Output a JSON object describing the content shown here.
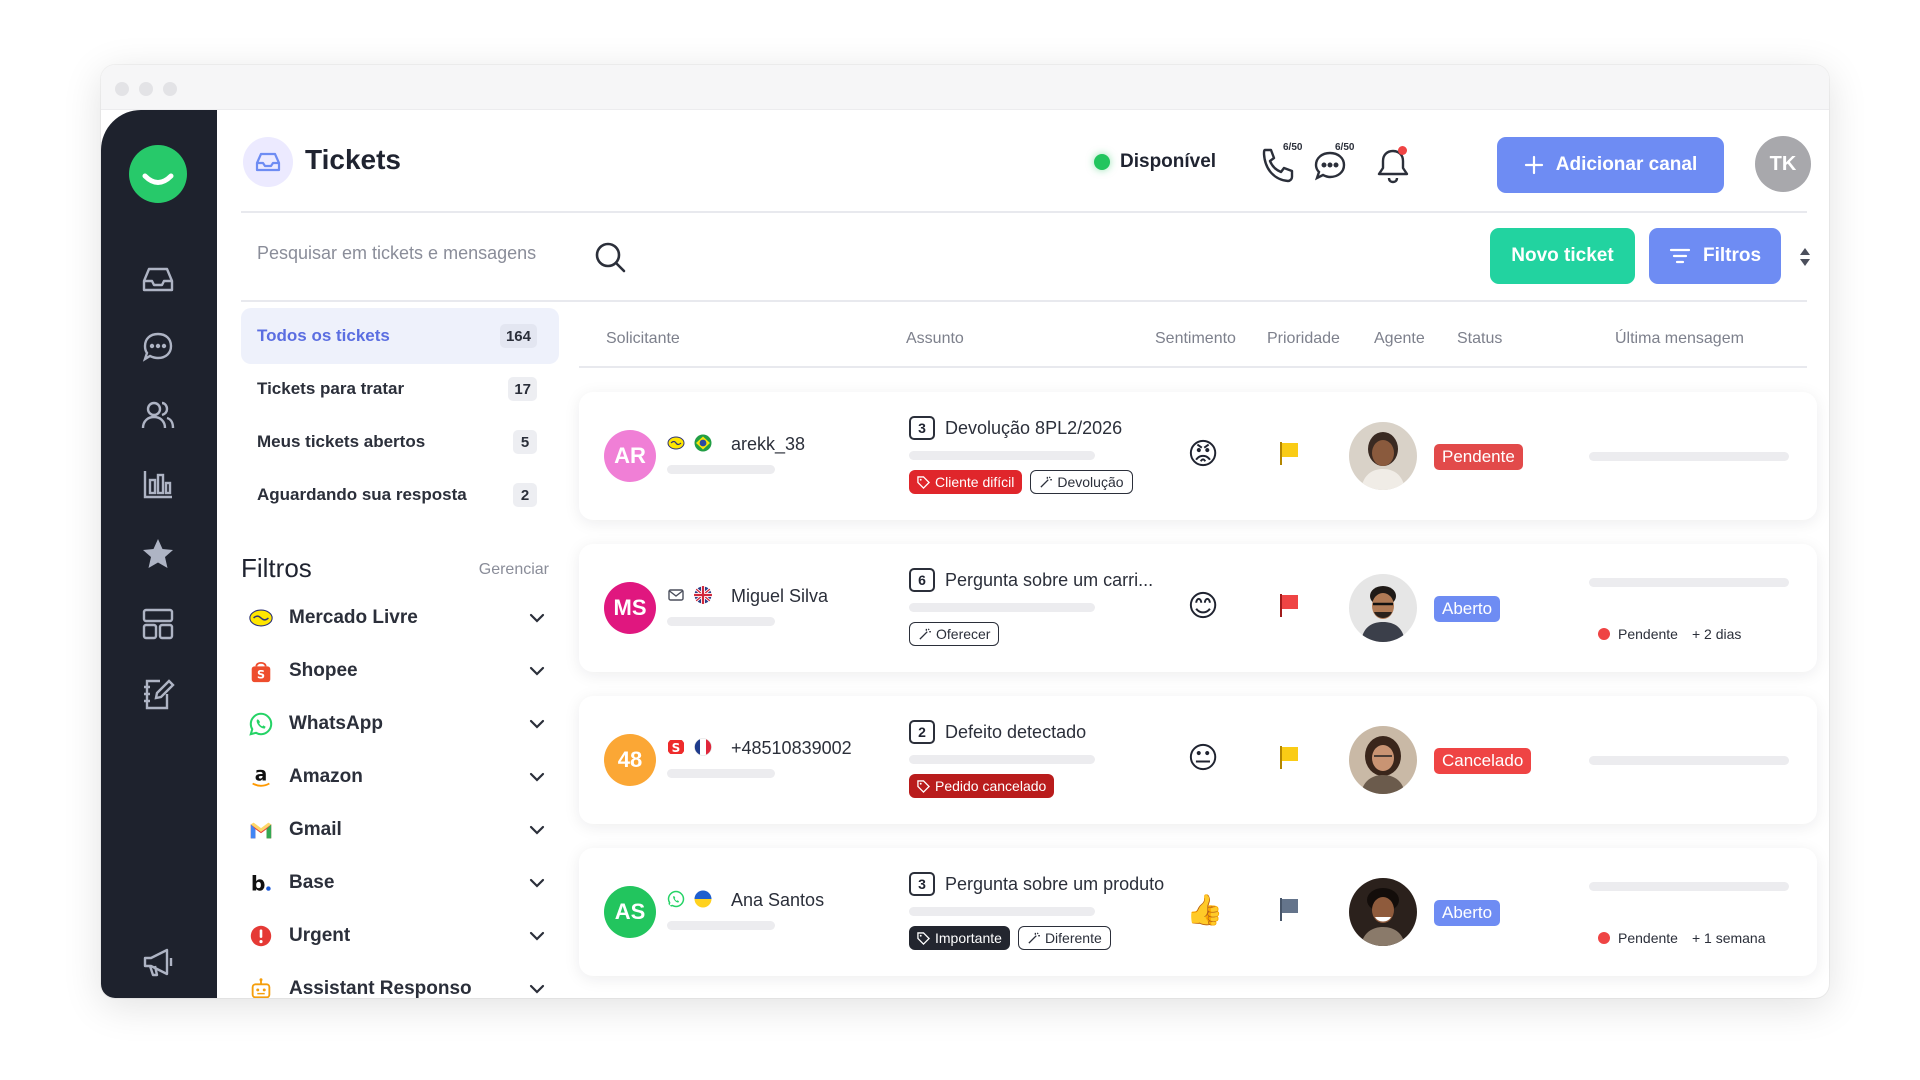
{
  "colors": {
    "accent": "#6e8cf3",
    "green": "#22d3a0",
    "sidebar": "#1e222d",
    "status_online": "#22c55e",
    "danger": "#ef4444"
  },
  "sidebar": {
    "logo": "app-logo",
    "items": [
      {
        "name": "inbox-icon"
      },
      {
        "name": "chat-bubble-icon"
      },
      {
        "name": "users-icon"
      },
      {
        "name": "bar-chart-icon"
      },
      {
        "name": "star-icon"
      },
      {
        "name": "layout-grid-icon"
      },
      {
        "name": "notebook-edit-icon"
      }
    ],
    "bottom_item": "megaphone-icon"
  },
  "header": {
    "title": "Tickets",
    "status_label": "Disponível",
    "phone_count": "6/50",
    "chat_count": "6/50",
    "add_channel_label": "Adicionar canal",
    "avatar_initials": "TK"
  },
  "search": {
    "placeholder": "Pesquisar em tickets e mensagens",
    "new_ticket_label": "Novo ticket",
    "filters_label": "Filtros"
  },
  "folders": [
    {
      "label": "Todos os tickets",
      "count": "164"
    },
    {
      "label": "Tickets para tratar",
      "count": "17"
    },
    {
      "label": "Meus tickets abertos",
      "count": "5"
    },
    {
      "label": "Aguardando sua resposta",
      "count": "2"
    }
  ],
  "filters": {
    "title": "Filtros",
    "manage_label": "Gerenciar",
    "channels": [
      {
        "label": "Mercado Livre",
        "icon": "mercado-livre-icon"
      },
      {
        "label": "Shopee",
        "icon": "shopee-icon"
      },
      {
        "label": "WhatsApp",
        "icon": "whatsapp-icon"
      },
      {
        "label": "Amazon",
        "icon": "amazon-icon"
      },
      {
        "label": "Gmail",
        "icon": "gmail-icon"
      },
      {
        "label": "Base",
        "icon": "base-icon"
      },
      {
        "label": "Urgent",
        "icon": "urgent-icon"
      },
      {
        "label": "Assistant Responso",
        "icon": "assistant-icon"
      }
    ]
  },
  "table": {
    "columns": [
      "Solicitante",
      "Assunto",
      "Sentimento",
      "Prioridade",
      "Agente",
      "Status",
      "Última mensagem"
    ],
    "rows": [
      {
        "initials": "AR",
        "avatar_color": "#f07fd6",
        "name": "arekk_38",
        "channel_icon": "mercado-livre-icon",
        "flag_icon": "brazil-flag-icon",
        "subject_count": "3",
        "subject": "Devolução 8PL2/2026",
        "tags": [
          {
            "label": "Cliente difícil",
            "style": "red"
          },
          {
            "label": "Devolução",
            "style": "outline"
          }
        ],
        "sentiment": "😡",
        "priority_color": "#facc15",
        "status": "Pendente",
        "status_style": "pend",
        "last_status": "",
        "last_time": ""
      },
      {
        "initials": "MS",
        "avatar_color": "#e0177f",
        "name": "Miguel Silva",
        "channel_icon": "email-icon",
        "flag_icon": "uk-flag-icon",
        "subject_count": "6",
        "subject": "Pergunta sobre um carri...",
        "tags": [
          {
            "label": "Oferecer",
            "style": "outline"
          }
        ],
        "sentiment": "😊",
        "priority_color": "#ef4444",
        "status": "Aberto",
        "status_style": "aber",
        "last_status": "Pendente",
        "last_time": "+ 2 dias"
      },
      {
        "initials": "48",
        "avatar_color": "#fba735",
        "name": "+48510839002",
        "channel_icon": "shopee-icon",
        "flag_icon": "france-flag-icon",
        "subject_count": "2",
        "subject": "Defeito detectado",
        "tags": [
          {
            "label": "Pedido cancelado",
            "style": "darkred"
          }
        ],
        "sentiment": "😐",
        "priority_color": "#facc15",
        "status": "Cancelado",
        "status_style": "canc",
        "last_status": "",
        "last_time": ""
      },
      {
        "initials": "AS",
        "avatar_color": "#22c55e",
        "name": "Ana Santos",
        "channel_icon": "whatsapp-icon",
        "flag_icon": "ukraine-flag-icon",
        "subject_count": "3",
        "subject": "Pergunta sobre um produto",
        "tags": [
          {
            "label": "Importante",
            "style": "dark"
          },
          {
            "label": "Diferente",
            "style": "outline"
          }
        ],
        "sentiment": "👍",
        "priority_color": "#64748b",
        "status": "Aberto",
        "status_style": "aber",
        "last_status": "Pendente",
        "last_time": "+ 1 semana"
      }
    ]
  }
}
